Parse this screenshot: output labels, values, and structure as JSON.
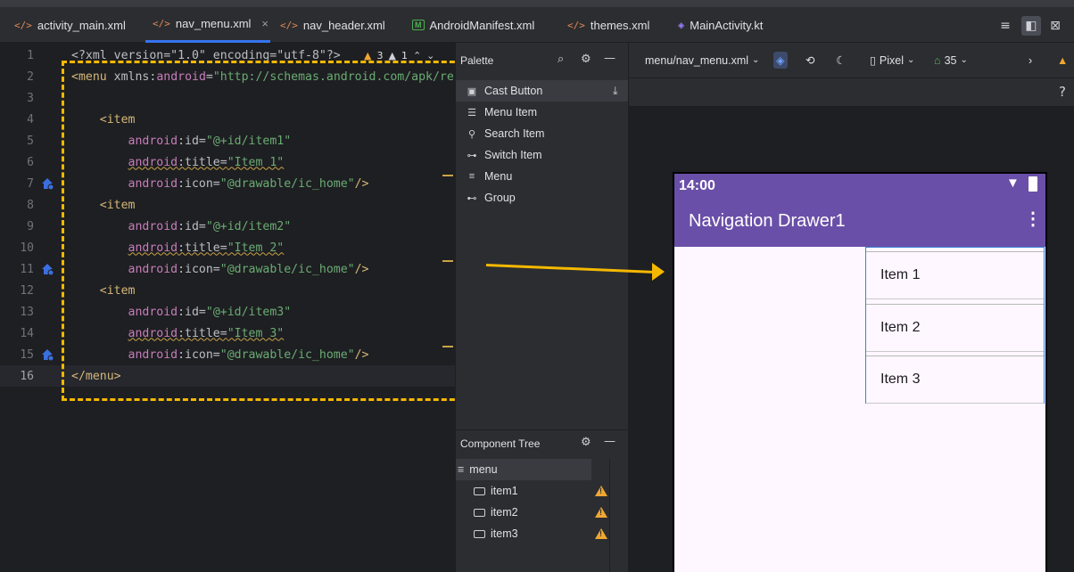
{
  "tabs": [
    {
      "label": "activity_main.xml",
      "icon": "xml-file-icon",
      "active": false
    },
    {
      "label": "nav_menu.xml",
      "icon": "xml-file-icon",
      "active": true
    },
    {
      "label": "nav_header.xml",
      "icon": "xml-file-icon",
      "active": false
    },
    {
      "label": "AndroidManifest.xml",
      "icon": "manifest-file-icon",
      "active": false
    },
    {
      "label": "themes.xml",
      "icon": "xml-file-icon",
      "active": false
    },
    {
      "label": "MainActivity.kt",
      "icon": "kotlin-file-icon",
      "active": false
    }
  ],
  "tab_close": "×",
  "editor": {
    "badges": {
      "warnings": "3",
      "weak_warnings": "1"
    },
    "lines": [
      {
        "n": "1",
        "parts": [
          [
            "plain",
            "<?xml version=\"1.0\" encoding=\"utf-8\"?>"
          ]
        ]
      },
      {
        "n": "2",
        "parts": [
          [
            "tag",
            "<menu"
          ],
          [
            "plain",
            " "
          ],
          [
            "attr",
            "xmlns"
          ],
          [
            "plain",
            ":"
          ],
          [
            "ns",
            "android"
          ],
          [
            "plain",
            "="
          ],
          [
            "str",
            "\"http://schemas.android.com/apk/res"
          ]
        ]
      },
      {
        "n": "3",
        "parts": []
      },
      {
        "n": "4",
        "parts": [
          [
            "plain",
            "    "
          ],
          [
            "tag",
            "<item"
          ]
        ]
      },
      {
        "n": "5",
        "parts": [
          [
            "plain",
            "        "
          ],
          [
            "ns",
            "android"
          ],
          [
            "plain",
            ":id="
          ],
          [
            "str",
            "\"@+id/item1\""
          ]
        ]
      },
      {
        "n": "6",
        "parts": [
          [
            "plain",
            "        "
          ],
          [
            "ns squig",
            "android"
          ],
          [
            "plain squig",
            ":title="
          ],
          [
            "str squig",
            "\"Item 1\""
          ]
        ]
      },
      {
        "n": "7",
        "parts": [
          [
            "plain",
            "        "
          ],
          [
            "ns",
            "android"
          ],
          [
            "plain",
            ":icon="
          ],
          [
            "str",
            "\"@drawable/ic_home\""
          ],
          [
            "tag",
            "/>"
          ]
        ],
        "mark": true
      },
      {
        "n": "8",
        "parts": [
          [
            "plain",
            "    "
          ],
          [
            "tag",
            "<item"
          ]
        ]
      },
      {
        "n": "9",
        "parts": [
          [
            "plain",
            "        "
          ],
          [
            "ns",
            "android"
          ],
          [
            "plain",
            ":id="
          ],
          [
            "str",
            "\"@+id/item2\""
          ]
        ]
      },
      {
        "n": "10",
        "parts": [
          [
            "plain",
            "        "
          ],
          [
            "ns squig",
            "android"
          ],
          [
            "plain squig",
            ":title="
          ],
          [
            "str squig",
            "\"Item 2\""
          ]
        ]
      },
      {
        "n": "11",
        "parts": [
          [
            "plain",
            "        "
          ],
          [
            "ns",
            "android"
          ],
          [
            "plain",
            ":icon="
          ],
          [
            "str",
            "\"@drawable/ic_home\""
          ],
          [
            "tag",
            "/>"
          ]
        ],
        "mark": true
      },
      {
        "n": "12",
        "parts": [
          [
            "plain",
            "    "
          ],
          [
            "tag",
            "<item"
          ]
        ]
      },
      {
        "n": "13",
        "parts": [
          [
            "plain",
            "        "
          ],
          [
            "ns",
            "android"
          ],
          [
            "plain",
            ":id="
          ],
          [
            "str",
            "\"@+id/item3\""
          ]
        ]
      },
      {
        "n": "14",
        "parts": [
          [
            "plain",
            "        "
          ],
          [
            "ns squig",
            "android"
          ],
          [
            "plain squig",
            ":title="
          ],
          [
            "str squig",
            "\"Item 3\""
          ]
        ]
      },
      {
        "n": "15",
        "parts": [
          [
            "plain",
            "        "
          ],
          [
            "ns",
            "android"
          ],
          [
            "plain",
            ":icon="
          ],
          [
            "str",
            "\"@drawable/ic_home\""
          ],
          [
            "tag",
            "/>"
          ]
        ],
        "mark": true
      },
      {
        "n": "16",
        "parts": [
          [
            "tag",
            "</menu>"
          ]
        ],
        "current": true
      }
    ]
  },
  "palette": {
    "title": "Palette",
    "items": [
      {
        "label": "Cast Button",
        "icon": "cast-icon"
      },
      {
        "label": "Menu Item",
        "icon": "menu-item-icon"
      },
      {
        "label": "Search Item",
        "icon": "search-item-icon"
      },
      {
        "label": "Switch Item",
        "icon": "switch-item-icon"
      },
      {
        "label": "Menu",
        "icon": "menu-icon"
      },
      {
        "label": "Group",
        "icon": "group-icon"
      }
    ]
  },
  "component_tree": {
    "title": "Component Tree",
    "root": "menu",
    "children": [
      "item1",
      "item2",
      "item3"
    ]
  },
  "design": {
    "file": "menu/nav_menu.xml",
    "device": "Pixel",
    "api": "35",
    "help": "?"
  },
  "phone": {
    "time": "14:00",
    "app_title": "Navigation Drawer1",
    "menu_items": [
      "Item 1",
      "Item 2",
      "Item 3"
    ],
    "accent": "#6a4fa8"
  },
  "colors": {
    "annotation": "#f5b800",
    "tab_active": "#3574f0"
  }
}
